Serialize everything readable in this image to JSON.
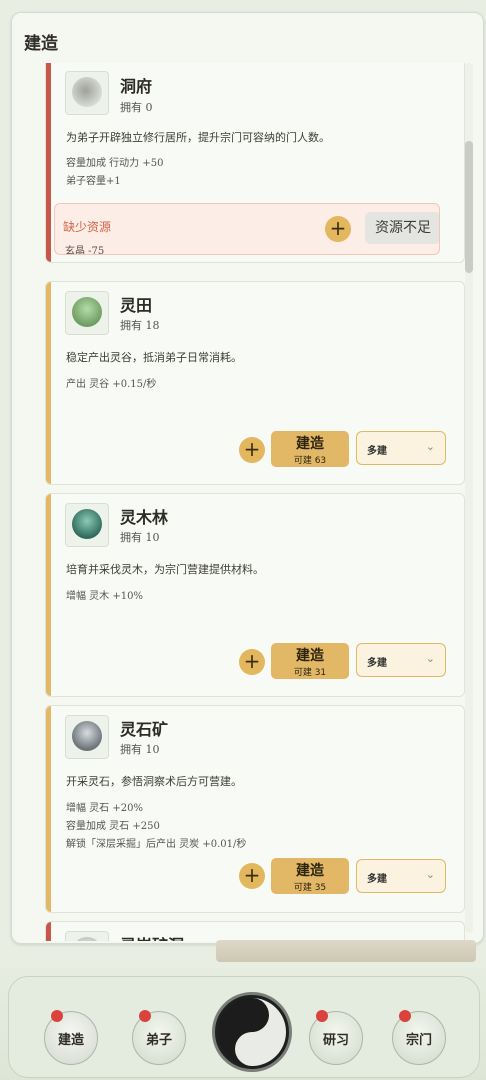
{
  "panel": {
    "title": "建造"
  },
  "buildings": [
    {
      "name": "洞府",
      "owned": "拥有 0",
      "description": "为弟子开辟独立修行居所，提升宗门可容纳的门人数。",
      "stats": [
        "容量加成 行动力 +50",
        "弟子容量+1"
      ],
      "missing_label": "缺少资源",
      "missing_detail": "玄晶 -75",
      "plus_label": "+",
      "button_label": "资源不足",
      "accent": "#c7574a",
      "icon": "cave-icon"
    },
    {
      "name": "灵田",
      "owned": "拥有 18",
      "description": "稳定产出灵谷，抵消弟子日常消耗。",
      "stats": [
        "产出 灵谷 +0.15/秒"
      ],
      "plus_label": "+",
      "build_label": "建造",
      "build_count": "可建 63",
      "select_value": "多建",
      "accent": "#e2b866",
      "icon": "spirit-field-icon"
    },
    {
      "name": "灵木林",
      "owned": "拥有 10",
      "description": "培育并采伐灵木，为宗门营建提供材料。",
      "stats": [
        "增幅 灵木 +10%"
      ],
      "plus_label": "+",
      "build_label": "建造",
      "build_count": "可建 31",
      "select_value": "多建",
      "accent": "#e2b866",
      "icon": "spirit-forest-icon"
    },
    {
      "name": "灵石矿",
      "owned": "拥有 10",
      "description": "开采灵石，参悟洞察术后方可营建。",
      "stats": [
        "增幅 灵石 +20%",
        "容量加成 灵石 +250",
        "解锁「深层采掘」后产出 灵炭 +0.01/秒"
      ],
      "plus_label": "+",
      "build_label": "建造",
      "build_count": "可建 35",
      "select_value": "多建",
      "accent": "#e2b866",
      "icon": "spirit-mine-icon"
    },
    {
      "name": "灵炭矿洞",
      "accent": "#c7574a",
      "icon": "charcoal-mine-icon"
    }
  ],
  "nav": {
    "build": "建造",
    "disciples": "弟子",
    "research": "研习",
    "sect": "宗门",
    "center_icon": "yin-yang-icon"
  }
}
